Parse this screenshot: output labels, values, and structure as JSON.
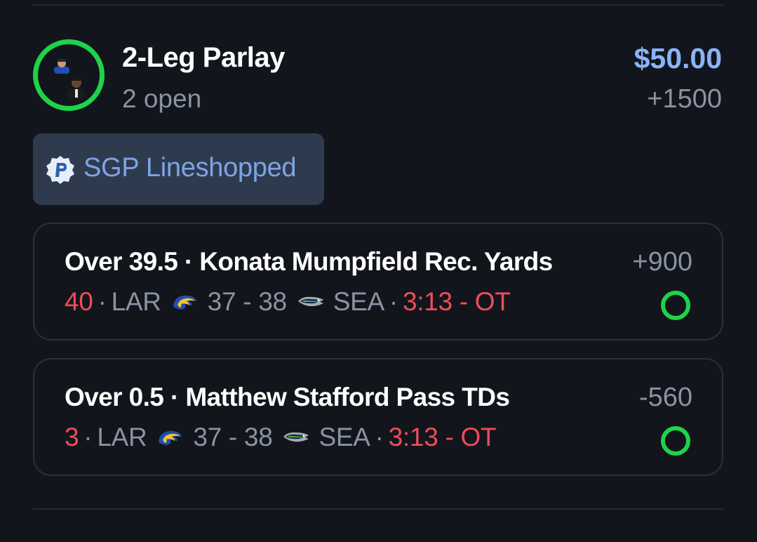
{
  "colors": {
    "background": "#12151c",
    "accent_blue": "#8ab4f8",
    "live_red": "#ef4c5a",
    "open_green": "#1ed34a",
    "muted": "#8a93a3",
    "badge_bg": "#2e3b4f"
  },
  "bet": {
    "title": "2-Leg Parlay",
    "subtitle": "2 open",
    "stake": "$50.00",
    "odds": "+1500",
    "avatar_icons": [
      "player-headshot-icon",
      "player-headshot-icon"
    ]
  },
  "badge": {
    "icon": "sgp-p-icon",
    "label": "SGP Lineshopped"
  },
  "legs": [
    {
      "line": "Over 39.5 · Konata Mumpfield Rec. Yards",
      "odds": "+900",
      "stat": "40",
      "sep1": "·",
      "home_team": "LAR",
      "home_logo": "rams-logo-icon",
      "score": "37 - 38",
      "away_logo": "seahawks-logo-icon",
      "away_team": "SEA",
      "sep2": "·",
      "clock": "3:13 - OT",
      "status_icon": "open-circle-icon"
    },
    {
      "line": "Over 0.5 · Matthew Stafford Pass TDs",
      "odds": "-560",
      "stat": "3",
      "sep1": "·",
      "home_team": "LAR",
      "home_logo": "rams-logo-icon",
      "score": "37 - 38",
      "away_logo": "seahawks-logo-icon",
      "away_team": "SEA",
      "sep2": "·",
      "clock": "3:13 - OT",
      "status_icon": "open-circle-icon"
    }
  ]
}
